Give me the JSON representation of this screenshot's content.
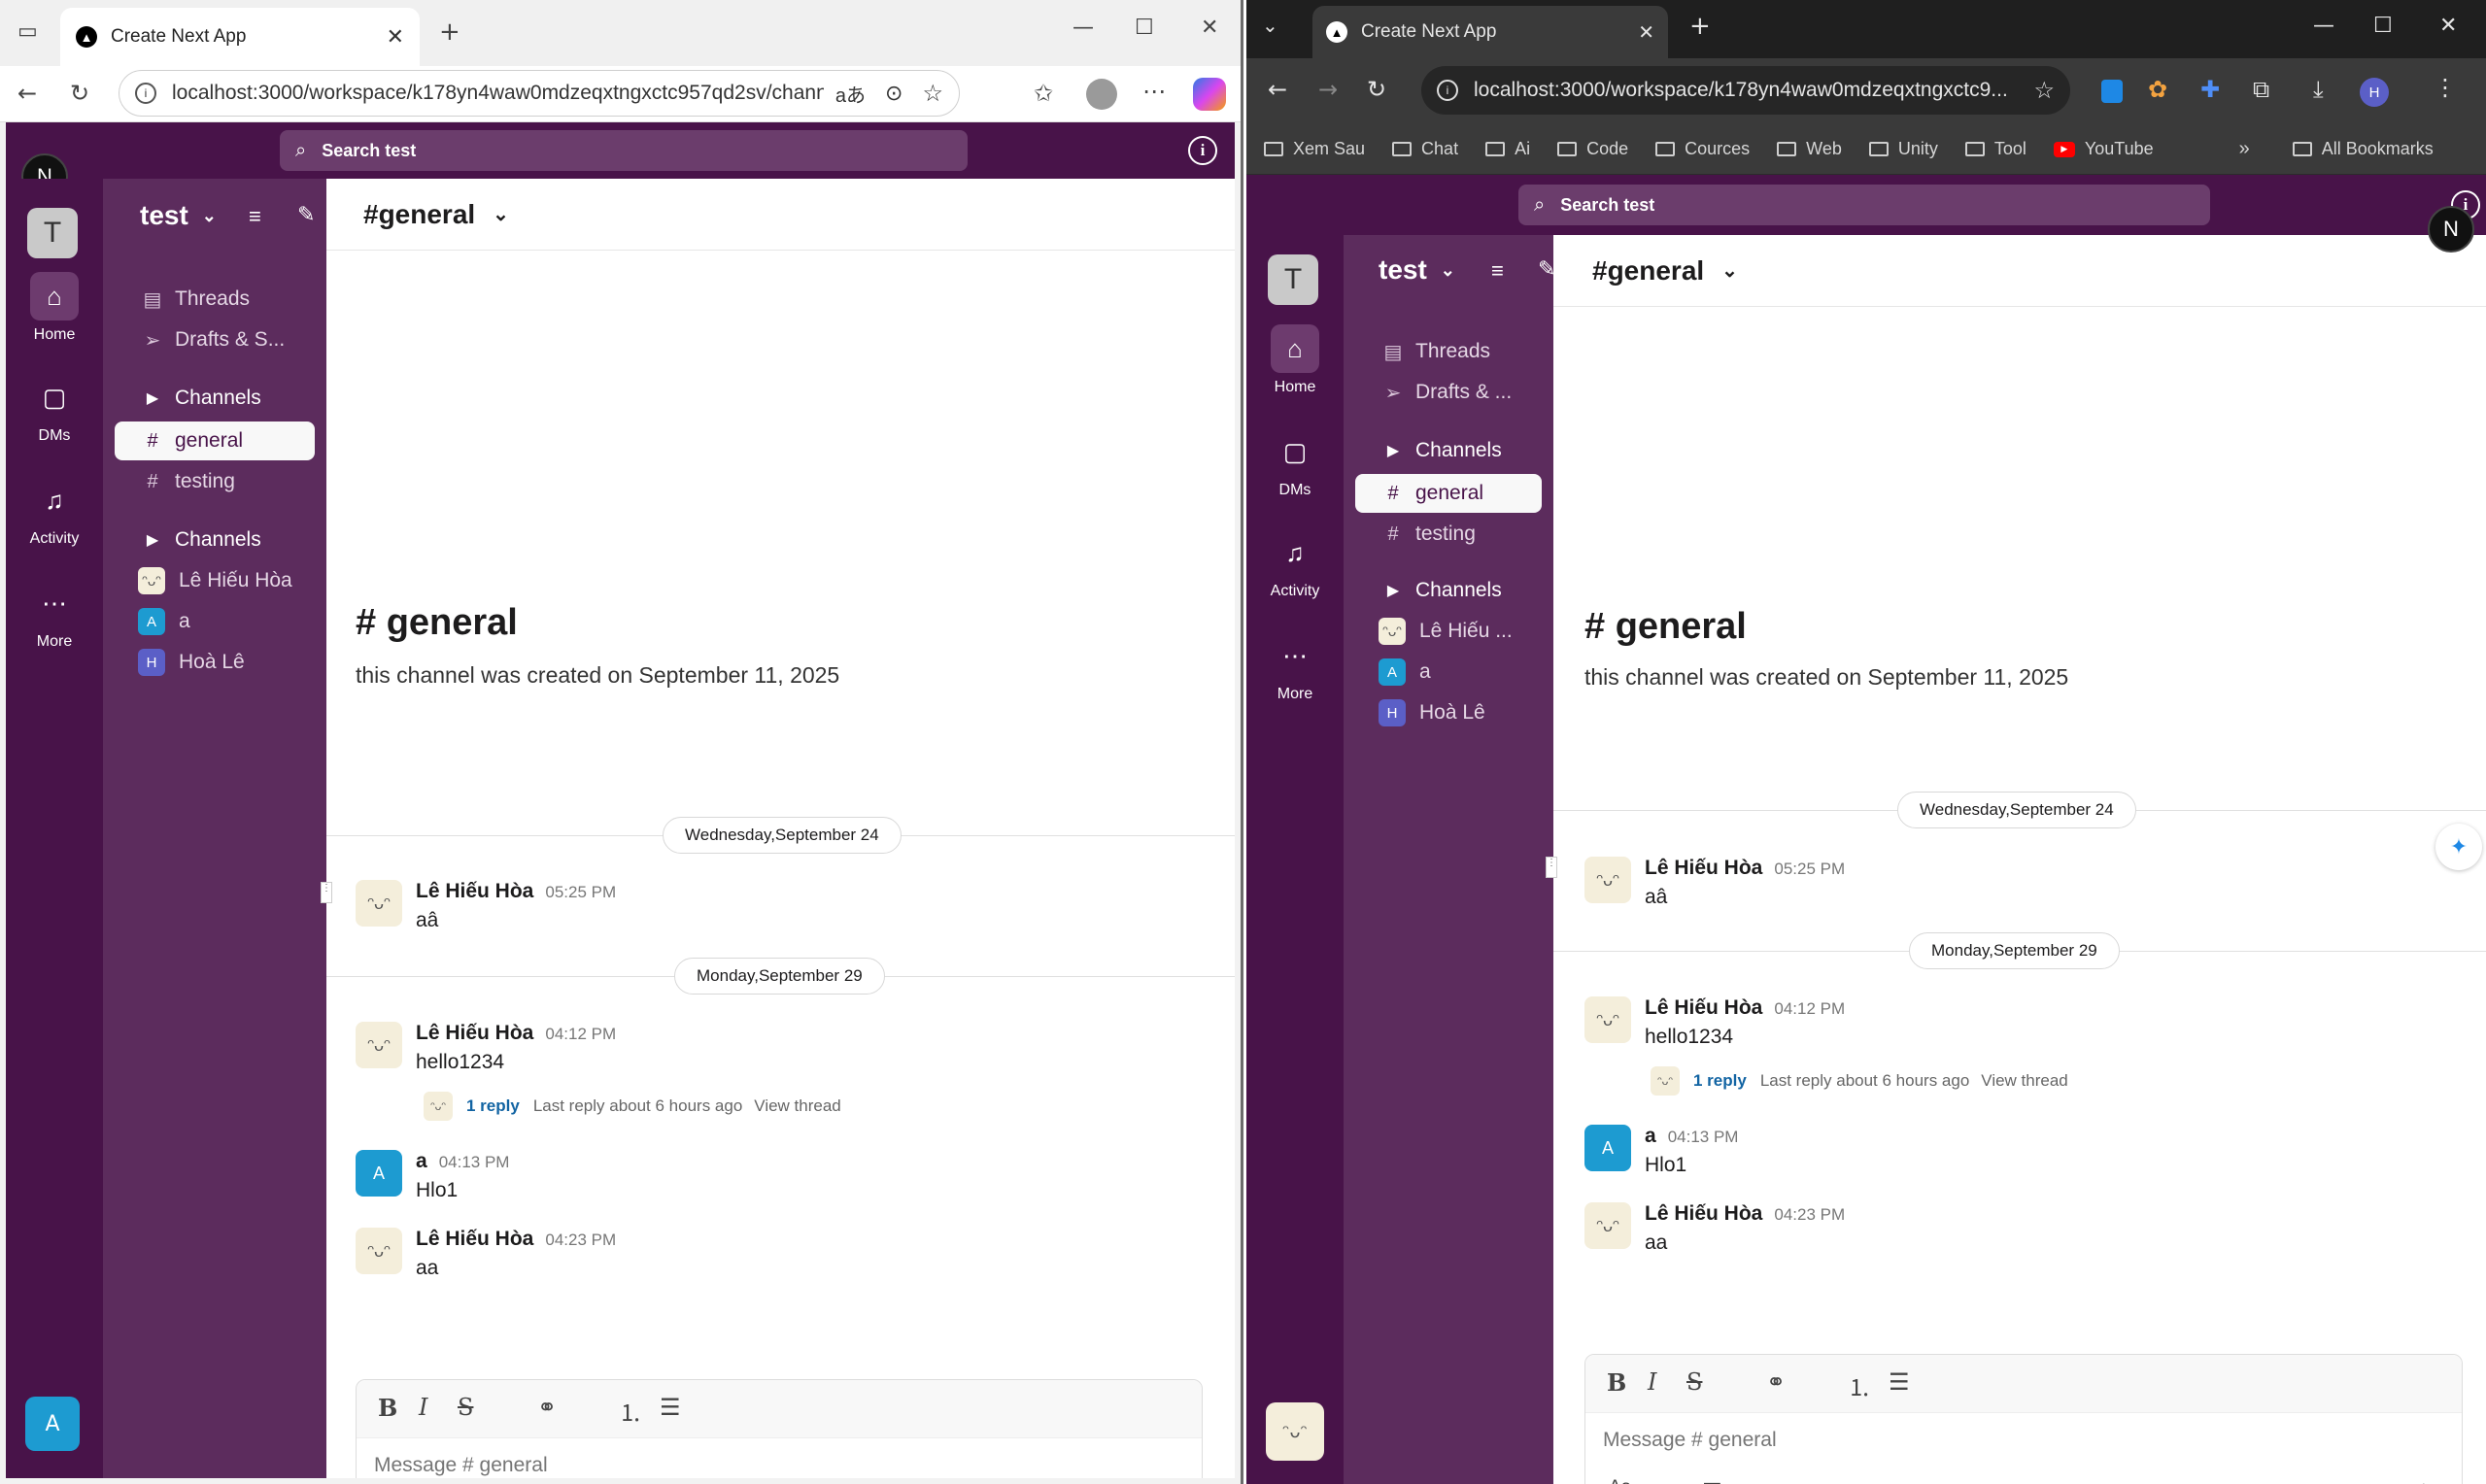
{
  "browser_left": {
    "tab_title": "Create Next App",
    "url": "localhost:3000/workspace/k178yn4waw0mdzeqxtngxctc957qd2sv/channel...",
    "read_aloud": "aあ"
  },
  "browser_right": {
    "tab_title": "Create Next App",
    "url": "localhost:3000/workspace/k178yn4waw0mdzeqxtngxctc9...",
    "bookmarks": [
      "Xem Sau",
      "Chat",
      "Ai",
      "Code",
      "Cources",
      "Web",
      "Unity",
      "Tool",
      "YouTube"
    ],
    "all_bookmarks": "All Bookmarks",
    "profile_letter": "H"
  },
  "app": {
    "search_placeholder": "Search test",
    "next_badge": "N",
    "workspace_letter": "T",
    "workspace_name": "test",
    "rail": [
      {
        "label": "Home",
        "icon": "home-icon"
      },
      {
        "label": "DMs",
        "icon": "message-icon"
      },
      {
        "label": "Activity",
        "icon": "bell-icon"
      },
      {
        "label": "More",
        "icon": "more-icon"
      }
    ],
    "user_avatar_left": "A",
    "sidebar": {
      "threads": "Threads",
      "drafts_left": "Drafts & S...",
      "drafts_right": "Drafts & ...",
      "channels_header": "Channels",
      "channels": [
        "general",
        "testing"
      ],
      "dm_header": "Channels",
      "dms_left": [
        {
          "name": "Lê Hiếu Hòa",
          "avatar": "e"
        },
        {
          "name": "a",
          "avatar": "A"
        },
        {
          "name": "Hoà Lê",
          "avatar": "H"
        }
      ],
      "dms_right": [
        {
          "name": "Lê Hiếu ...",
          "avatar": "e"
        },
        {
          "name": "a",
          "avatar": "A"
        },
        {
          "name": "Hoà Lê",
          "avatar": "H"
        }
      ]
    },
    "channel": {
      "header": "#general",
      "title": "# general",
      "created": "this channel was created on September 11, 2025",
      "dates": [
        "Wednesday,September 24",
        "Monday,September 29"
      ]
    },
    "messages": [
      {
        "author": "Lê Hiếu Hòa",
        "time": "05:25 PM",
        "text": "aâ",
        "avatar": "emoji"
      },
      {
        "author": "Lê Hiếu Hòa",
        "time": "04:12 PM",
        "text": "hello1234",
        "avatar": "emoji"
      },
      {
        "author": "a",
        "time": "04:13 PM",
        "text": "Hlo1",
        "avatar": "A"
      },
      {
        "author": "Lê Hiếu Hòa",
        "time": "04:23 PM",
        "text": "aa",
        "avatar": "emoji"
      }
    ],
    "thread": {
      "count": "1 reply",
      "last": "Last reply about 6 hours ago",
      "view": "View thread"
    },
    "composer": {
      "placeholder": "Message # general"
    }
  }
}
